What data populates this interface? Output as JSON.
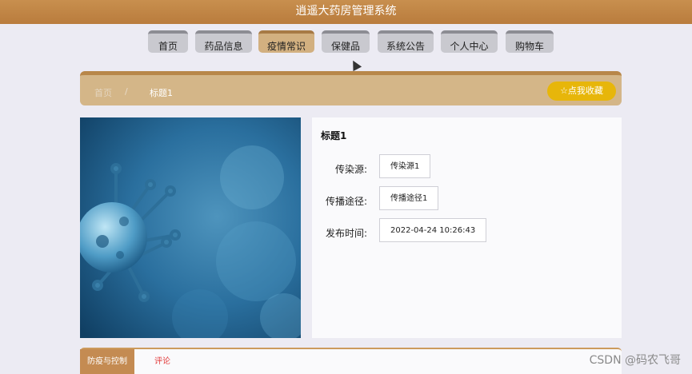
{
  "app": {
    "title": "逍遥大药房管理系统"
  },
  "nav": {
    "tabs": [
      "首页",
      "药品信息",
      "疫情常识",
      "保健品",
      "系统公告",
      "个人中心",
      "购物车"
    ],
    "active_index": 2
  },
  "breadcrumb": {
    "home": "首页",
    "separator": "/",
    "current": "标题1"
  },
  "favorite_button": {
    "label": "☆点我收藏"
  },
  "detail": {
    "title": "标题1",
    "source_label": "传染源:",
    "source_value": "传染源1",
    "route_label": "传播途径:",
    "route_value": "传播途径1",
    "time_label": "发布时间:",
    "time_value": "2022-04-24 10:26:43"
  },
  "bottom_tabs": {
    "tab1": "防疫与控制",
    "tab2": "评论"
  },
  "watermark": "CSDN @码农飞哥",
  "colors": {
    "header": "#c08643",
    "accent": "#d4b688",
    "favorite": "#e7b60a"
  }
}
